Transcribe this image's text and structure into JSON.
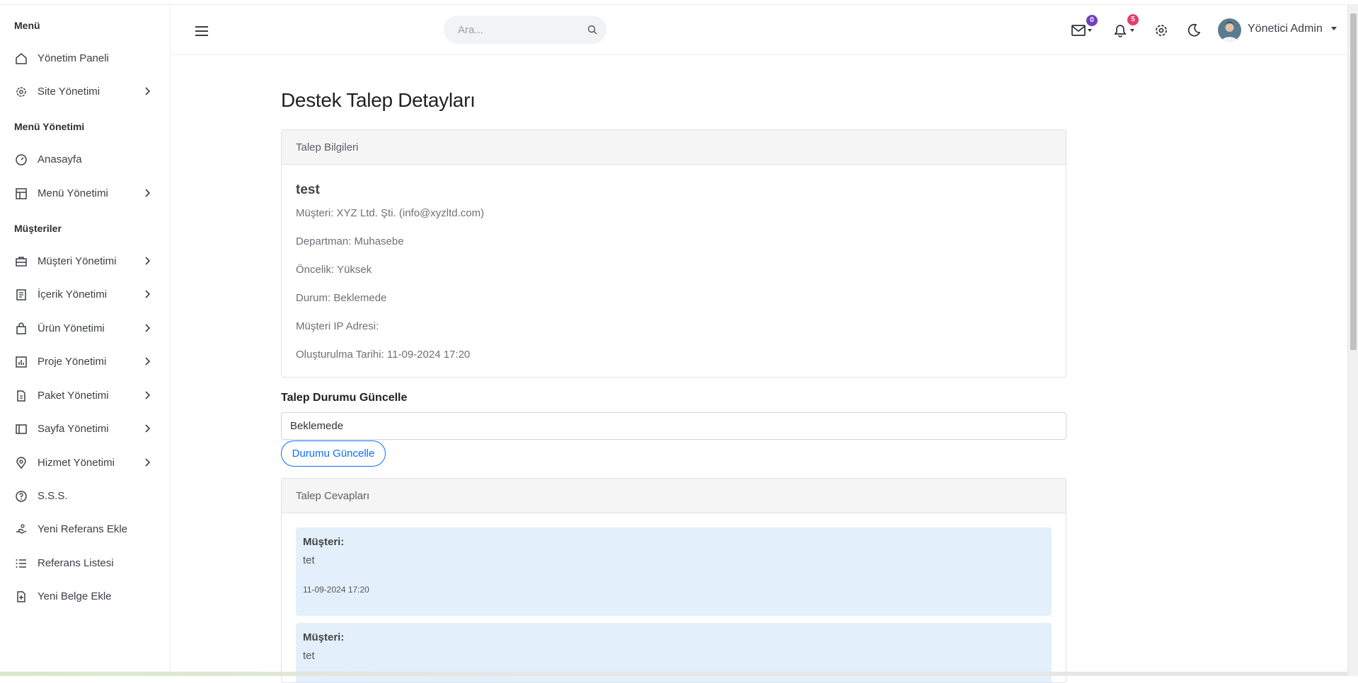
{
  "sidebar": {
    "sections": [
      "Menü",
      "Menü Yönetimi",
      "Müşteriler"
    ],
    "items": [
      {
        "label": "Yönetim Paneli",
        "icon": "home-icon",
        "chevron": false
      },
      {
        "label": "Site Yönetimi",
        "icon": "gear-icon",
        "chevron": true
      },
      {
        "label": "Anasayfa",
        "icon": "dashboard-icon",
        "chevron": false
      },
      {
        "label": "Menü Yönetimi",
        "icon": "layout-icon",
        "chevron": true
      },
      {
        "label": "Müşteri Yönetimi",
        "icon": "briefcase-icon",
        "chevron": true
      },
      {
        "label": "İçerik Yönetimi",
        "icon": "document-icon",
        "chevron": true
      },
      {
        "label": "Ürün Yönetimi",
        "icon": "shopping-bag-icon",
        "chevron": true
      },
      {
        "label": "Proje Yönetimi",
        "icon": "chart-icon",
        "chevron": true
      },
      {
        "label": "Paket Yönetimi",
        "icon": "file-icon",
        "chevron": true
      },
      {
        "label": "Sayfa Yönetimi",
        "icon": "sidebar-layout-icon",
        "chevron": true
      },
      {
        "label": "Hizmet Yönetimi",
        "icon": "location-pin-icon",
        "chevron": true
      },
      {
        "label": "S.S.S.",
        "icon": "question-circle-icon",
        "chevron": false
      },
      {
        "label": "Yeni Referans Ekle",
        "icon": "hand-icon",
        "chevron": false
      },
      {
        "label": "Referans Listesi",
        "icon": "list-icon",
        "chevron": false
      },
      {
        "label": "Yeni Belge Ekle",
        "icon": "file-add-icon",
        "chevron": false
      }
    ]
  },
  "header": {
    "search_placeholder": "Ara...",
    "mail_badge": "0",
    "notification_badge": "5",
    "user_name": "Yönetici Admin"
  },
  "main": {
    "title": "Destek Talep Detayları",
    "info_card": {
      "header": "Talep Bilgileri",
      "subject": "test",
      "lines": [
        "Müşteri: XYZ Ltd. Şti. (info@xyzltd.com)",
        "Departman: Muhasebe",
        "Öncelik: Yüksek",
        "Durum: Beklemede",
        "Müşteri IP Adresi:",
        "Oluşturulma Tarihi: 11-09-2024 17:20"
      ]
    },
    "status_update": {
      "label": "Talep Durumu Güncelle",
      "selected": "Beklemede",
      "button": "Durumu Güncelle"
    },
    "replies_card": {
      "header": "Talep Cevapları",
      "replies": [
        {
          "author": "Müşteri:",
          "message": "tet",
          "time": "11-09-2024 17:20"
        },
        {
          "author": "Müşteri:",
          "message": "tet",
          "time": ""
        }
      ]
    }
  },
  "colors": {
    "accent": "#0d6efd",
    "mail_badge": "#6f42c1",
    "notification_badge": "#e83e6c",
    "reply_bg": "#e3f0fb"
  }
}
